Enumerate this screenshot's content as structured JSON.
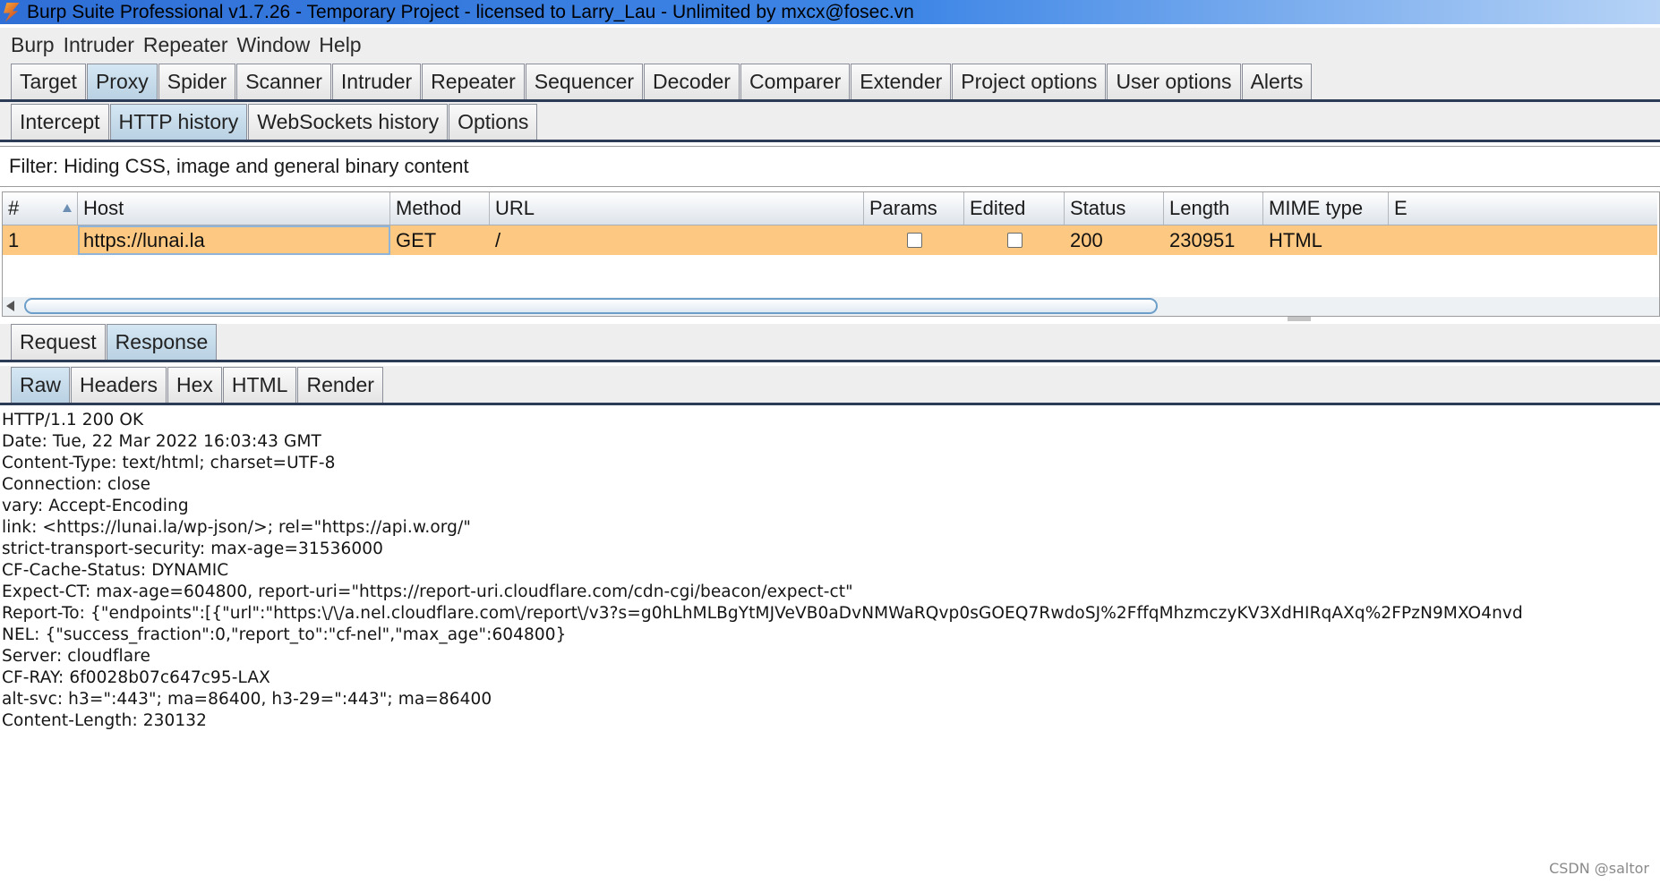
{
  "window": {
    "title": "Burp Suite Professional v1.7.26 - Temporary Project - licensed to Larry_Lau - Unlimited by mxcx@fosec.vn",
    "icon": "burp-logo-icon"
  },
  "menubar": {
    "items": [
      "Burp",
      "Intruder",
      "Repeater",
      "Window",
      "Help"
    ]
  },
  "main_tabs": {
    "items": [
      "Target",
      "Proxy",
      "Spider",
      "Scanner",
      "Intruder",
      "Repeater",
      "Sequencer",
      "Decoder",
      "Comparer",
      "Extender",
      "Project options",
      "User options",
      "Alerts"
    ],
    "active": "Proxy"
  },
  "proxy_tabs": {
    "items": [
      "Intercept",
      "HTTP history",
      "WebSockets history",
      "Options"
    ],
    "active": "HTTP history"
  },
  "filter": {
    "text": "Filter: Hiding CSS, image and general binary content"
  },
  "history_table": {
    "columns": [
      "#",
      "Host",
      "Method",
      "URL",
      "Params",
      "Edited",
      "Status",
      "Length",
      "MIME type",
      "E"
    ],
    "sort_column": "#",
    "sort_direction": "ascending",
    "rows": [
      {
        "num": "1",
        "host": "https://lunai.la",
        "method": "GET",
        "url": "/",
        "params": false,
        "edited": false,
        "status": "200",
        "length": "230951",
        "mime": "HTML",
        "extra": ""
      }
    ],
    "row_highlight": "#fdc982"
  },
  "message_tabs": {
    "items": [
      "Request",
      "Response"
    ],
    "active": "Response"
  },
  "view_tabs": {
    "items": [
      "Raw",
      "Headers",
      "Hex",
      "HTML",
      "Render"
    ],
    "active": "Raw"
  },
  "response_raw": {
    "lines": [
      "HTTP/1.1 200 OK",
      "Date: Tue, 22 Mar 2022 16:03:43 GMT",
      "Content-Type: text/html; charset=UTF-8",
      "Connection: close",
      "vary: Accept-Encoding",
      "link: <https://lunai.la/wp-json/>; rel=\"https://api.w.org/\"",
      "strict-transport-security: max-age=31536000",
      "CF-Cache-Status: DYNAMIC",
      "Expect-CT: max-age=604800, report-uri=\"https://report-uri.cloudflare.com/cdn-cgi/beacon/expect-ct\"",
      "Report-To: {\"endpoints\":[{\"url\":\"https:\\/\\/a.nel.cloudflare.com\\/report\\/v3?s=g0hLhMLBgYtMJVeVB0aDvNMWaRQvp0sGOEQ7RwdoSJ%2FffqMhzmczyKV3XdHIRqAXq%2FPzN9MXO4nvd",
      "NEL: {\"success_fraction\":0,\"report_to\":\"cf-nel\",\"max_age\":604800}",
      "Server: cloudflare",
      "CF-RAY: 6f0028b07c647c95-LAX",
      "alt-svc: h3=\":443\"; ma=86400, h3-29=\":443\"; ma=86400",
      "Content-Length: 230132"
    ]
  },
  "watermark": "CSDN @saltor"
}
